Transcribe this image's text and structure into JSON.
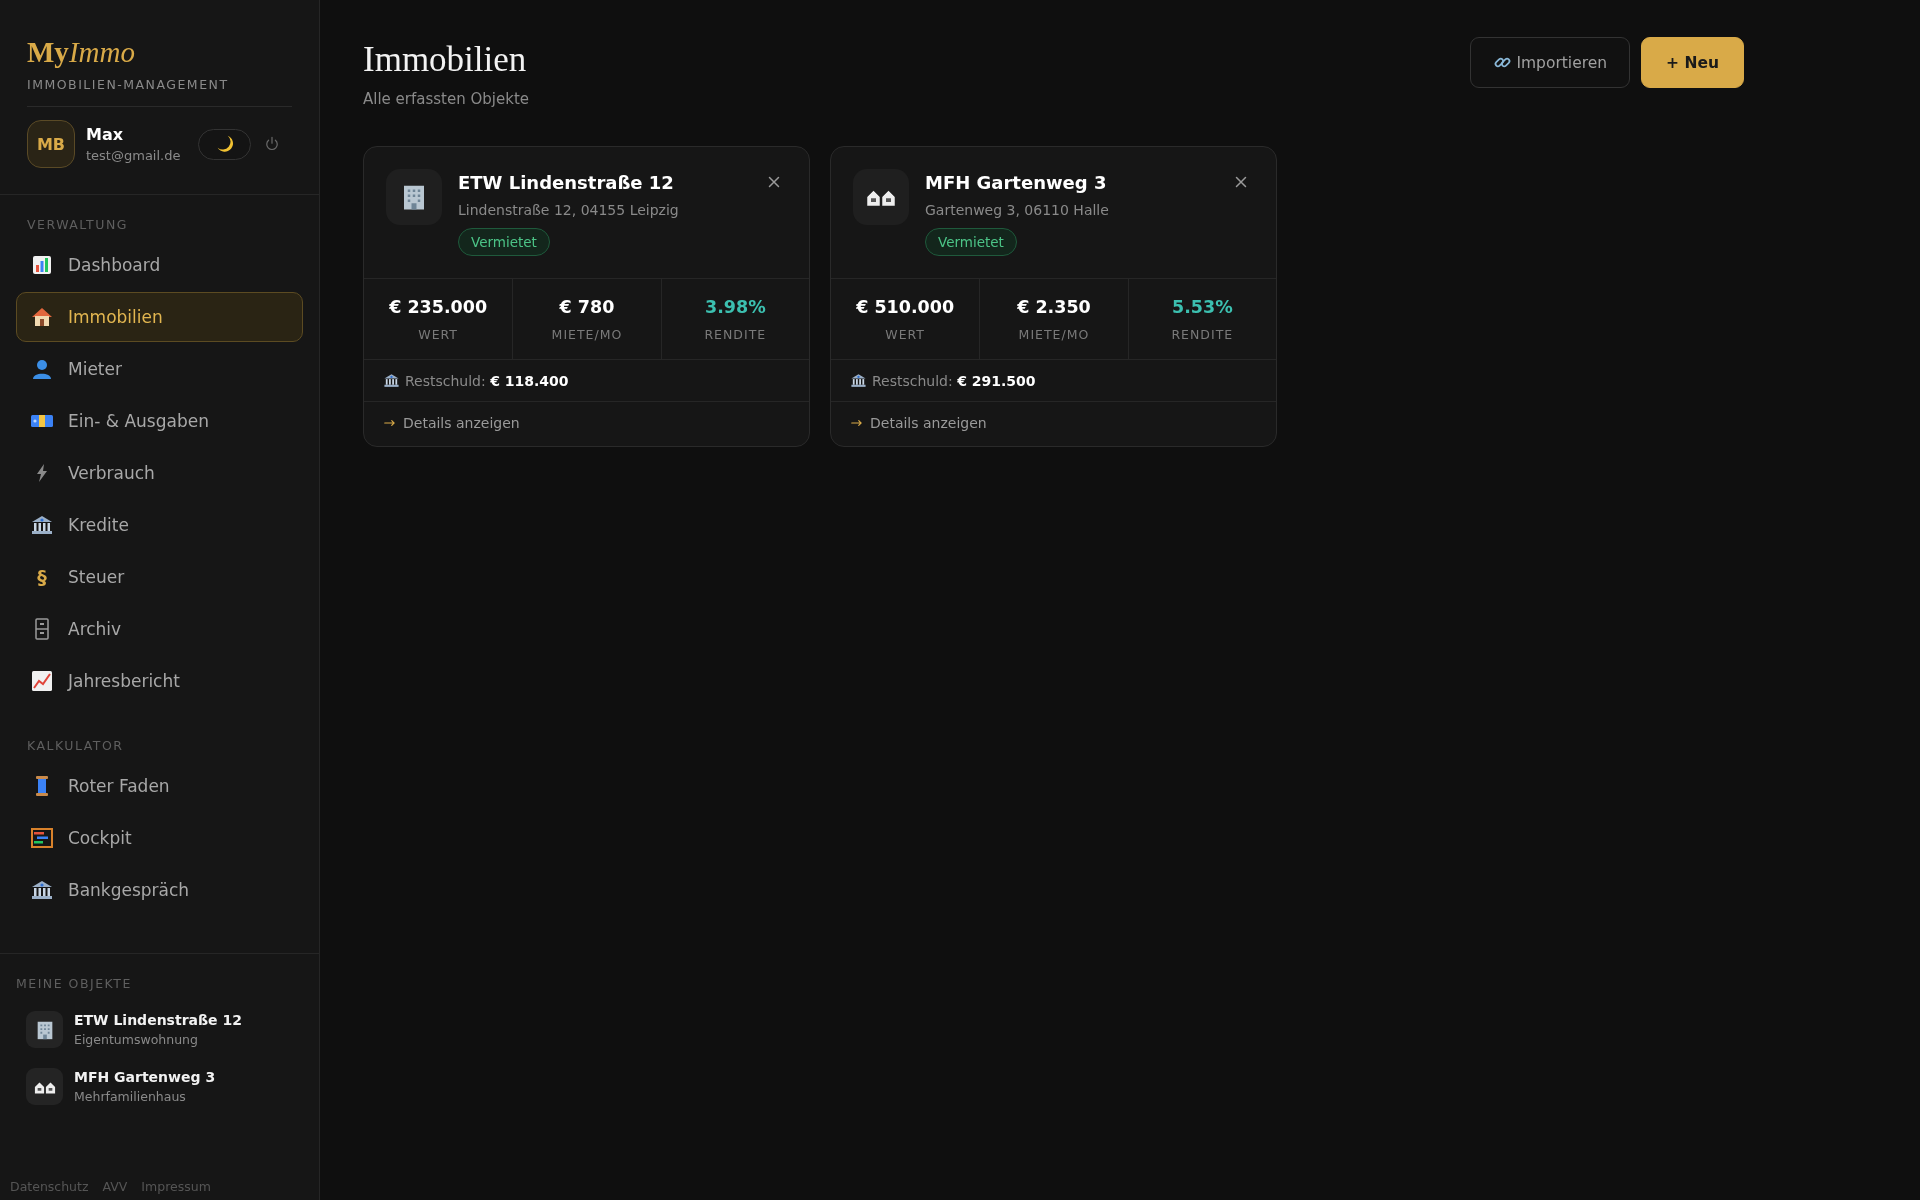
{
  "brand": {
    "strong": "My",
    "italic": "Immo",
    "subtitle": "IMMOBILIEN-MANAGEMENT"
  },
  "user": {
    "initials": "MB",
    "name": "Max",
    "email": "test@gmail.de",
    "dark_mode": true
  },
  "nav_sections": [
    {
      "title": "VERWALTUNG",
      "items": [
        {
          "label": "Dashboard",
          "selected": false
        },
        {
          "label": "Immobilien",
          "selected": true
        },
        {
          "label": "Mieter",
          "selected": false
        },
        {
          "label": "Ein- & Ausgaben",
          "selected": false
        },
        {
          "label": "Verbrauch",
          "selected": false
        },
        {
          "label": "Kredite",
          "selected": false
        },
        {
          "label": "Steuer",
          "selected": false,
          "glyph": "§"
        },
        {
          "label": "Archiv",
          "selected": false
        },
        {
          "label": "Jahresbericht",
          "selected": false
        }
      ]
    },
    {
      "title": "KALKULATOR",
      "items": [
        {
          "label": "Roter Faden",
          "selected": false
        },
        {
          "label": "Cockpit",
          "selected": false
        },
        {
          "label": "Bankgespräch",
          "selected": false
        }
      ]
    }
  ],
  "my_objects": {
    "title": "MEINE OBJEKTE",
    "items": [
      {
        "name": "ETW Lindenstraße 12",
        "type": "Eigentumswohnung"
      },
      {
        "name": "MFH Gartenweg 3",
        "type": "Mehrfamilienhaus"
      }
    ]
  },
  "footer_links": [
    "Datenschutz",
    "AVV",
    "Impressum"
  ],
  "page": {
    "title": "Immobilien",
    "subtitle": "Alle erfassten Objekte"
  },
  "actions": {
    "import": "Importieren",
    "new": "+ Neu"
  },
  "properties": [
    {
      "name": "ETW Lindenstraße 12",
      "address": "Lindenstraße 12, 04155 Leipzig",
      "status": "Vermietet",
      "stats": [
        {
          "value": "€ 235.000",
          "label": "WERT"
        },
        {
          "value": "€ 780",
          "label": "MIETE/MO"
        },
        {
          "value": "3.98%",
          "label": "RENDITE"
        }
      ],
      "debt": "Restschuld: **€ 118.400**",
      "details": "Details anzeigen"
    },
    {
      "name": "MFH Gartenweg 3",
      "address": "Gartenweg 3, 06110 Halle",
      "status": "Vermietet",
      "stats": [
        {
          "value": "€ 510.000",
          "label": "WERT"
        },
        {
          "value": "€ 2.350",
          "label": "MIETE/MO"
        },
        {
          "value": "5.53%",
          "label": "RENDITE"
        }
      ],
      "debt": "Restschuld: **€ 291.500**",
      "details": "Details anzeigen"
    }
  ]
}
